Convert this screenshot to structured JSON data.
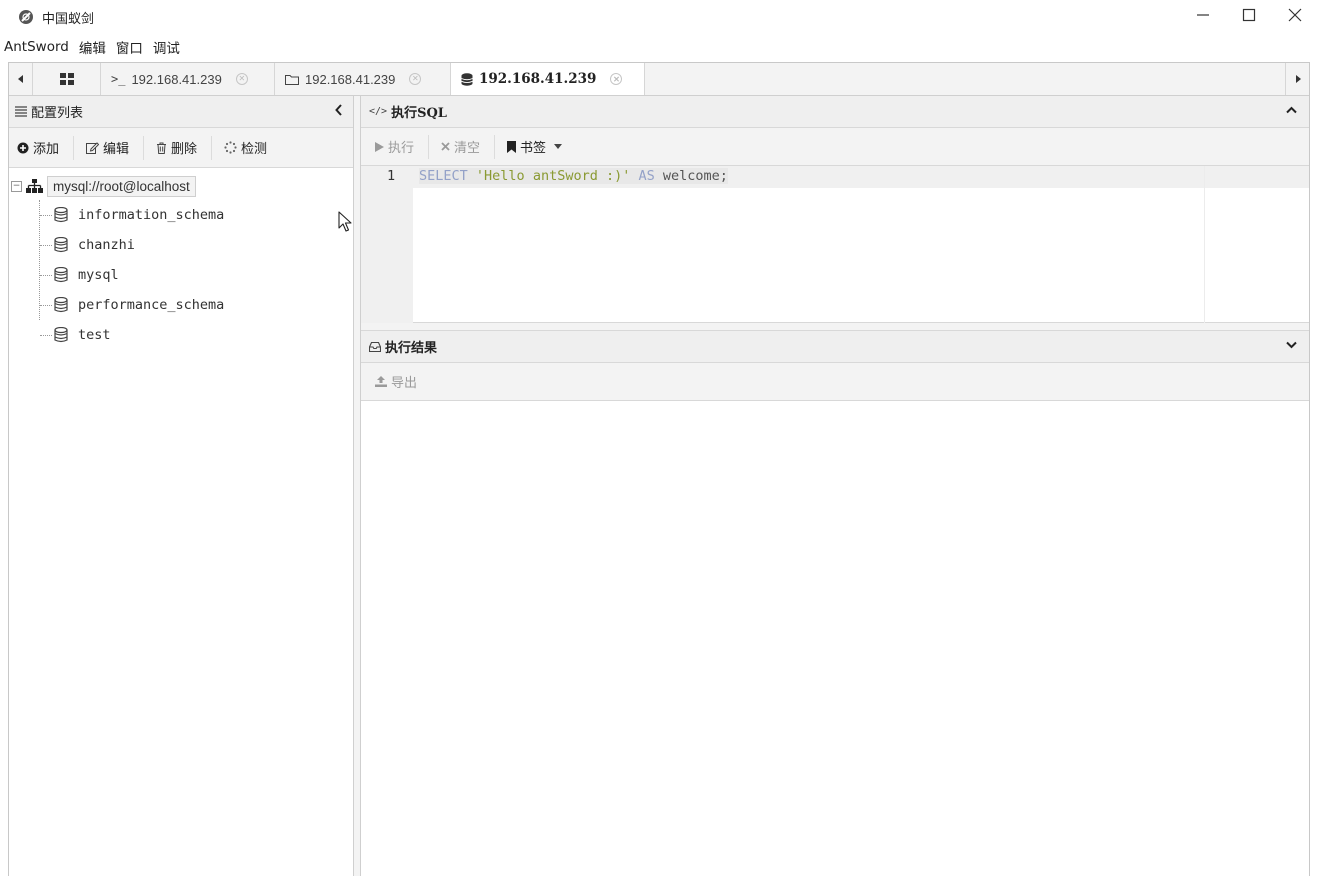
{
  "window": {
    "title": "中国蚁剑"
  },
  "menu": {
    "items": [
      "AntSword",
      "编辑",
      "窗口",
      "调试"
    ]
  },
  "tabs": [
    {
      "label": "192.168.41.239",
      "type": "terminal"
    },
    {
      "label": "192.168.41.239",
      "type": "files"
    },
    {
      "label": "192.168.41.239",
      "type": "database",
      "active": true
    }
  ],
  "left_panel": {
    "title": "配置列表",
    "toolbar": {
      "add": "添加",
      "edit": "编辑",
      "delete": "删除",
      "detect": "检测"
    },
    "tree": {
      "root": "mysql://root@localhost",
      "children": [
        "information_schema",
        "chanzhi",
        "mysql",
        "performance_schema",
        "test"
      ]
    }
  },
  "sql_panel": {
    "title": "执行SQL",
    "toolbar": {
      "execute": "执行",
      "clear": "清空",
      "bookmark": "书签"
    },
    "editor": {
      "line_number": "1",
      "code": {
        "kw1": "SELECT",
        "str": "'Hello antSword :)'",
        "kw2": "AS",
        "id": "welcome;"
      }
    }
  },
  "results_panel": {
    "title": "执行结果",
    "toolbar": {
      "export": "导出"
    }
  },
  "colors": {
    "panel_bg": "#f3f3f3",
    "header_bg": "#efefef",
    "border": "#cfcfcf",
    "keyword": "#93a1c8",
    "string": "#8a9a32"
  }
}
